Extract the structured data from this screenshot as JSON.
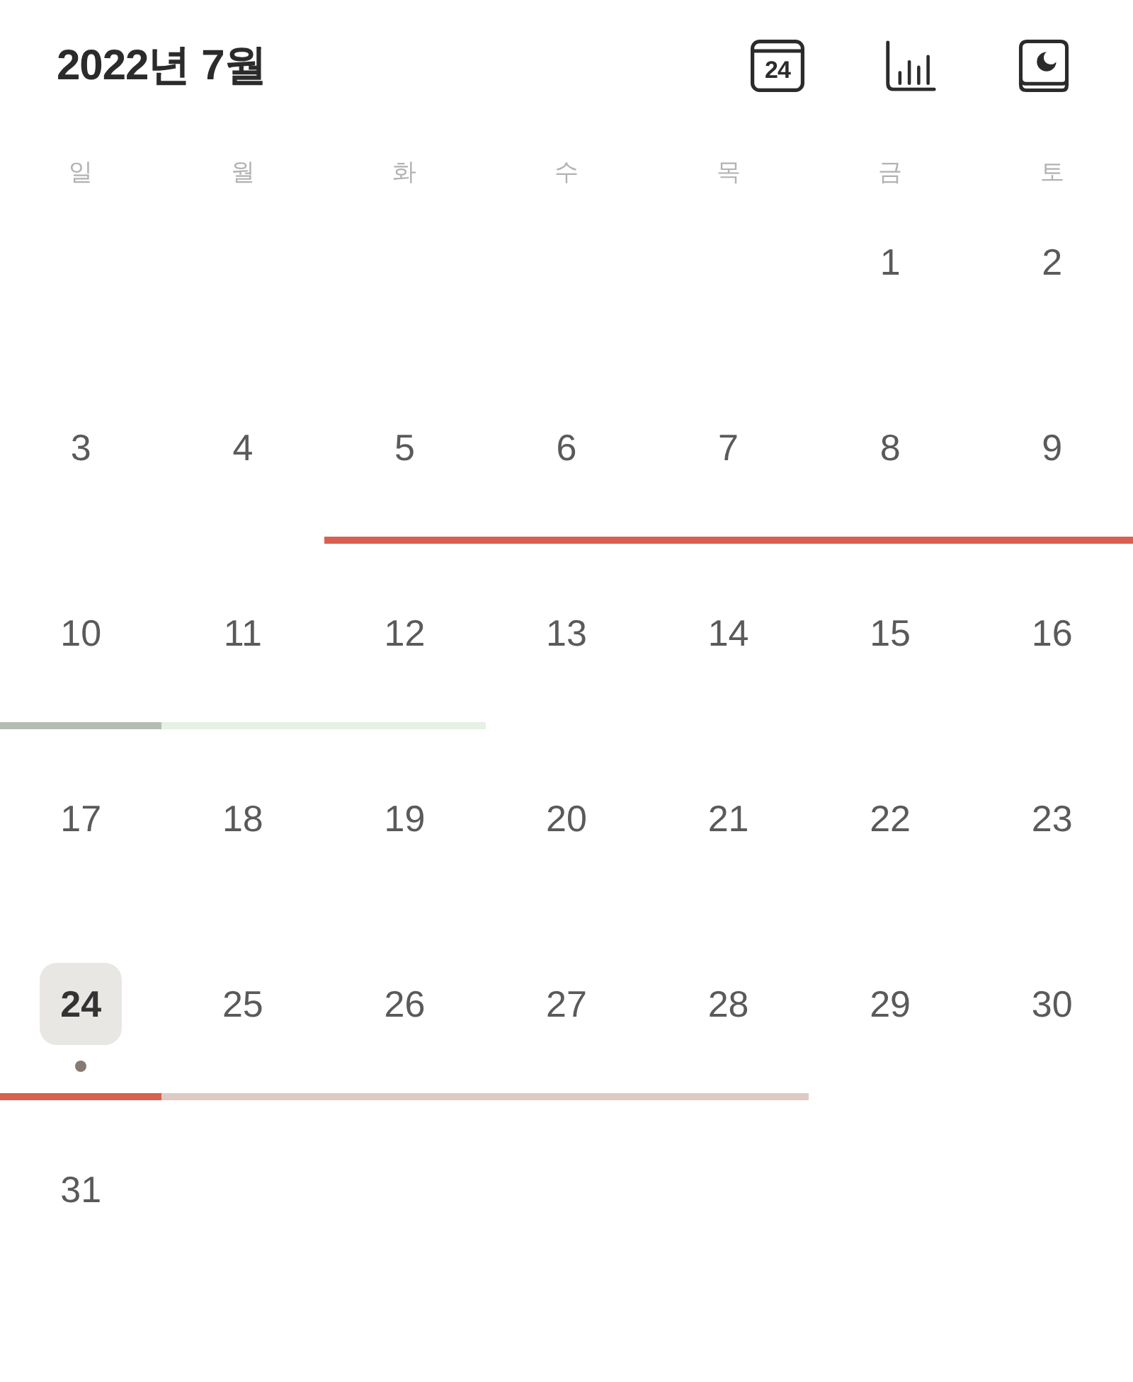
{
  "header": {
    "title": "2022년 7월",
    "actions": [
      {
        "kind": "today",
        "label": "24"
      },
      {
        "kind": "stats"
      },
      {
        "kind": "journal"
      }
    ]
  },
  "weekdays": [
    "일",
    "월",
    "화",
    "수",
    "목",
    "금",
    "토"
  ],
  "weeks": [
    {
      "days": [
        {
          "kind": "blank"
        },
        {
          "kind": "blank"
        },
        {
          "kind": "blank"
        },
        {
          "kind": "blank"
        },
        {
          "kind": "blank"
        },
        {
          "kind": "day",
          "label": "1",
          "selected": false,
          "has_entry": false
        },
        {
          "kind": "day",
          "label": "2",
          "selected": false,
          "has_entry": false
        }
      ]
    },
    {
      "days": [
        {
          "kind": "day",
          "label": "3",
          "selected": false,
          "has_entry": false
        },
        {
          "kind": "day",
          "label": "4",
          "selected": false,
          "has_entry": false
        },
        {
          "kind": "day",
          "label": "5",
          "selected": false,
          "has_entry": false,
          "color": "#d8604f"
        },
        {
          "kind": "day",
          "label": "6",
          "selected": false,
          "has_entry": false,
          "color": "#d8604f"
        },
        {
          "kind": "day",
          "label": "7",
          "selected": false,
          "has_entry": false,
          "color": "#d8604f"
        },
        {
          "kind": "day",
          "label": "8",
          "selected": false,
          "has_entry": false,
          "color": "#d8604f"
        },
        {
          "kind": "day",
          "label": "9",
          "selected": false,
          "has_entry": false,
          "color": "#d8604f"
        }
      ]
    },
    {
      "days": [
        {
          "kind": "day",
          "label": "10",
          "selected": false,
          "has_entry": false,
          "color": "#b3bdb3"
        },
        {
          "kind": "day",
          "label": "11",
          "selected": false,
          "has_entry": false,
          "color": "#e5f1e3"
        },
        {
          "kind": "day",
          "label": "12",
          "selected": false,
          "has_entry": false,
          "color": "#e5f1e3"
        },
        {
          "kind": "day",
          "label": "13",
          "selected": false,
          "has_entry": false
        },
        {
          "kind": "day",
          "label": "14",
          "selected": false,
          "has_entry": false
        },
        {
          "kind": "day",
          "label": "15",
          "selected": false,
          "has_entry": false
        },
        {
          "kind": "day",
          "label": "16",
          "selected": false,
          "has_entry": false
        }
      ]
    },
    {
      "days": [
        {
          "kind": "day",
          "label": "17",
          "selected": false,
          "has_entry": false
        },
        {
          "kind": "day",
          "label": "18",
          "selected": false,
          "has_entry": false
        },
        {
          "kind": "day",
          "label": "19",
          "selected": false,
          "has_entry": false
        },
        {
          "kind": "day",
          "label": "20",
          "selected": false,
          "has_entry": false
        },
        {
          "kind": "day",
          "label": "21",
          "selected": false,
          "has_entry": false
        },
        {
          "kind": "day",
          "label": "22",
          "selected": false,
          "has_entry": false
        },
        {
          "kind": "day",
          "label": "23",
          "selected": false,
          "has_entry": false
        }
      ]
    },
    {
      "days": [
        {
          "kind": "day",
          "label": "24",
          "selected": true,
          "has_entry": true,
          "color": "#d8604f"
        },
        {
          "kind": "day",
          "label": "25",
          "selected": false,
          "has_entry": false,
          "color": "#dfc9c3"
        },
        {
          "kind": "day",
          "label": "26",
          "selected": false,
          "has_entry": false,
          "color": "#dfc9c3"
        },
        {
          "kind": "day",
          "label": "27",
          "selected": false,
          "has_entry": false,
          "color": "#dfc9c3"
        },
        {
          "kind": "day",
          "label": "28",
          "selected": false,
          "has_entry": false,
          "color": "#dfc9c3"
        },
        {
          "kind": "day",
          "label": "29",
          "selected": false,
          "has_entry": false
        },
        {
          "kind": "day",
          "label": "30",
          "selected": false,
          "has_entry": false
        }
      ]
    },
    {
      "days": [
        {
          "kind": "day",
          "label": "31",
          "selected": false,
          "has_entry": false
        },
        {
          "kind": "blank"
        },
        {
          "kind": "blank"
        },
        {
          "kind": "blank"
        },
        {
          "kind": "blank"
        },
        {
          "kind": "blank"
        },
        {
          "kind": "blank"
        }
      ]
    }
  ]
}
